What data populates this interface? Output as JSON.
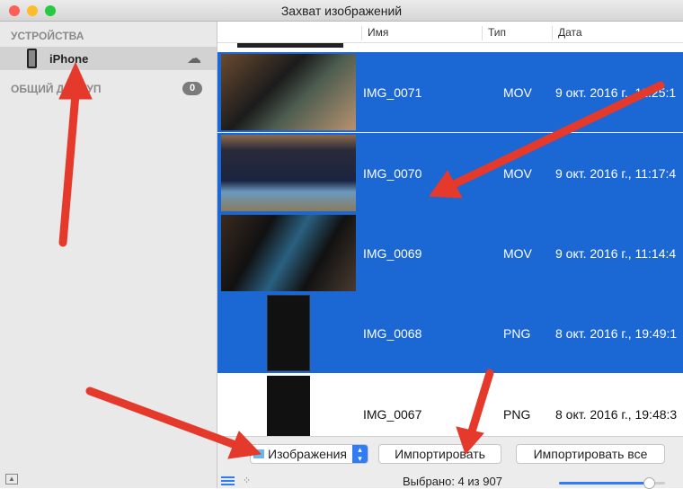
{
  "window": {
    "title": "Захват изображений"
  },
  "sidebar": {
    "devices_header": "УСТРОЙСТВА",
    "device_name": "iPhone",
    "shared_header": "ОБЩИЙ ДОСТУП",
    "shared_count": "0"
  },
  "table": {
    "columns": [
      "Имя",
      "Тип",
      "Дата"
    ],
    "rows": [
      {
        "name": "IMG_0071",
        "type": "MOV",
        "date": "9 окт. 2016 г., 11:25:1",
        "selected": true
      },
      {
        "name": "IMG_0070",
        "type": "MOV",
        "date": "9 окт. 2016 г., 11:17:4",
        "selected": true
      },
      {
        "name": "IMG_0069",
        "type": "MOV",
        "date": "9 окт. 2016 г., 11:14:4",
        "selected": true
      },
      {
        "name": "IMG_0068",
        "type": "PNG",
        "date": "8 окт. 2016 г., 19:49:1",
        "selected": true
      },
      {
        "name": "IMG_0067",
        "type": "PNG",
        "date": "8 окт. 2016 г., 19:48:3",
        "selected": false
      }
    ]
  },
  "toolbar": {
    "destination": "Изображения",
    "import_label": "Импортировать",
    "import_all_label": "Импортировать все",
    "status": "Выбрано: 4 из 907",
    "thumb_size": 0.85
  },
  "colors": {
    "selection": "#1b67d3",
    "annotation": "#e5392b"
  }
}
